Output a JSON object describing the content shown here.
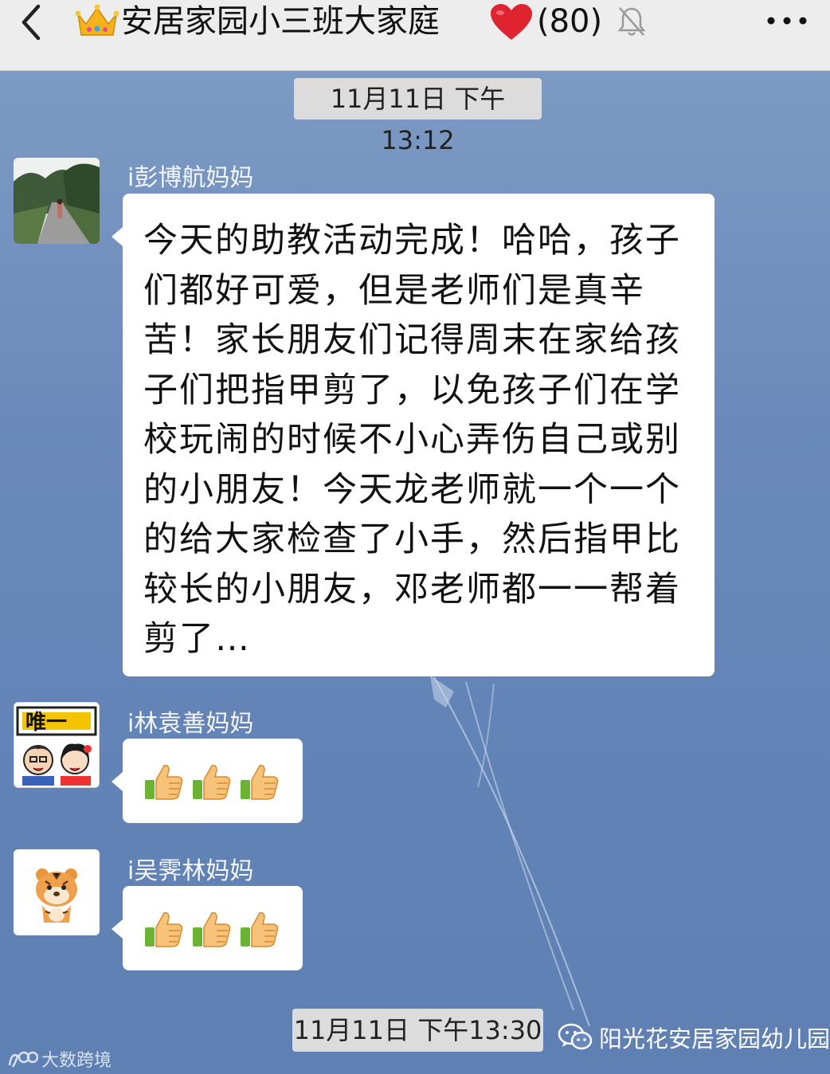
{
  "header": {
    "title": "安居家园小三班大家庭",
    "member_count": "(80)",
    "icons": {
      "back": "chevron-left-icon",
      "crown": "crown-emoji-icon",
      "heart": "red-heart-emoji-icon",
      "mute": "muted-bell-icon",
      "more": "more-dots-icon"
    }
  },
  "chat": {
    "timestamp_top": "11月11日 下午13:12",
    "timestamp_bottom": "11月11日 下午13:30",
    "messages": [
      {
        "sender": "i彭博航妈妈",
        "text": "今天的助教活动完成！哈哈，孩子们都好可爱，但是老师们是真辛苦！家长朋友们记得周末在家给孩子们把指甲剪了，以免孩子们在学校玩闹的时候不小心弄伤自己或别的小朋友！今天龙老师就一个一个的给大家检查了小手，然后指甲比较长的小朋友，邓老师都一一帮着剪了…",
        "avatar": "photo-avatar-road"
      },
      {
        "sender": "i林袁善妈妈",
        "text": "",
        "avatar": "cartoon-couple-avatar",
        "avatar_label": "唯一",
        "reaction": "thumbs-up-emoji x3"
      },
      {
        "sender": "i吴霁林妈妈",
        "text": "",
        "avatar": "tiger-cartoon-avatar",
        "reaction": "thumbs-up-emoji x3"
      }
    ]
  },
  "watermarks": {
    "left": "大数跨境",
    "right": "阳光花安居家园幼儿园"
  },
  "colors": {
    "chat_background": "#6b8abb",
    "topbar": "#ededed",
    "bubble": "#ffffff",
    "timestamp_pill": "#dcdcdc",
    "heart": "#e0242f",
    "crown": "#f4b21b"
  }
}
